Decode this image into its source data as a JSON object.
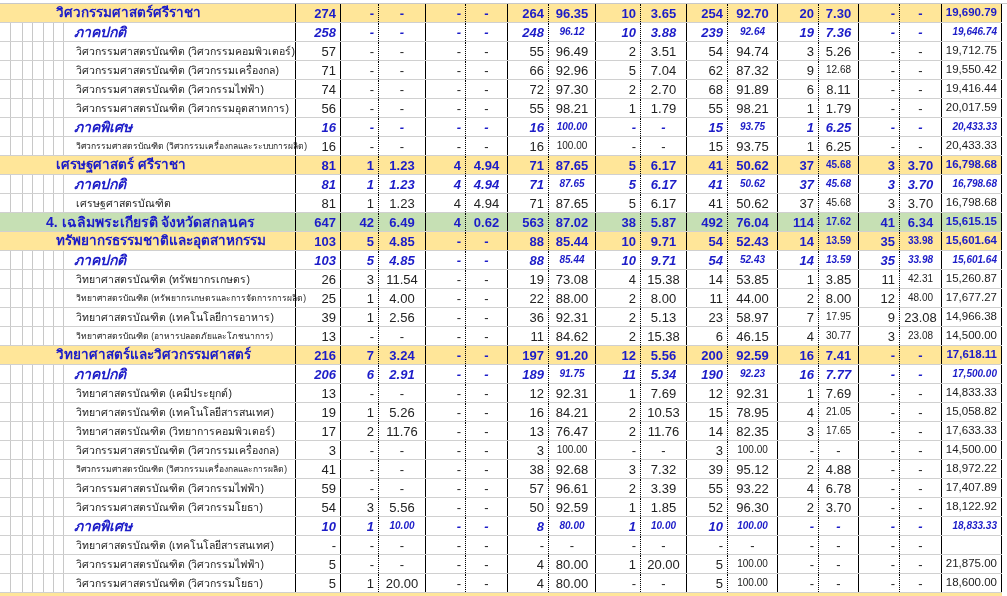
{
  "rows": [
    {
      "kind": "faculty",
      "label": "วิศวกรรมศาสตร์ศรีราชา",
      "cells": [
        "274",
        "-",
        "-",
        "-",
        "-",
        "264",
        "96.35",
        "10",
        "3.65",
        "254",
        "92.70",
        "20",
        "7.30",
        "-",
        "-",
        "19,690.79"
      ]
    },
    {
      "kind": "section",
      "label": "ภาคปกติ",
      "cells": [
        "258",
        "-",
        "-",
        "-",
        "-",
        "248",
        {
          "text": "96.12",
          "shrunk": true
        },
        "10",
        "3.88",
        "239",
        {
          "text": "92.64",
          "shrunk": true
        },
        "19",
        "7.36",
        "-",
        "-",
        {
          "text": "19,646.74",
          "shrunk": true
        }
      ]
    },
    {
      "kind": "program",
      "compact": false,
      "label": "วิศวกรรมศาสตรบัณฑิต (วิศวกรรมคอมพิวเตอร์)",
      "cells": [
        "57",
        "-",
        "-",
        "-",
        "-",
        "55",
        "96.49",
        "2",
        "3.51",
        "54",
        "94.74",
        "3",
        "5.26",
        "-",
        "-",
        "19,712.75"
      ]
    },
    {
      "kind": "program",
      "compact": false,
      "label": "วิศวกรรมศาสตรบัณฑิต (วิศวกรรมเครื่องกล)",
      "cells": [
        "71",
        "-",
        "-",
        "-",
        "-",
        "66",
        "92.96",
        "5",
        "7.04",
        "62",
        "87.32",
        "9",
        {
          "text": "12.68",
          "shrunk": true
        },
        "-",
        "-",
        "19,550.42"
      ]
    },
    {
      "kind": "program",
      "compact": false,
      "label": "วิศวกรรมศาสตรบัณฑิต (วิศวกรรมไฟฟ้า)",
      "cells": [
        "74",
        "-",
        "-",
        "-",
        "-",
        "72",
        "97.30",
        "2",
        "2.70",
        "68",
        "91.89",
        "6",
        "8.11",
        "-",
        "-",
        "19,416.44"
      ]
    },
    {
      "kind": "program",
      "compact": false,
      "label": "วิศวกรรมศาสตรบัณฑิต (วิศวกรรมอุตสาหการ)",
      "cells": [
        "56",
        "-",
        "-",
        "-",
        "-",
        "55",
        "98.21",
        "1",
        "1.79",
        "55",
        "98.21",
        "1",
        "1.79",
        "-",
        "-",
        "20,017.59"
      ]
    },
    {
      "kind": "section",
      "label": "ภาคพิเศษ",
      "cells": [
        "16",
        "-",
        "-",
        "-",
        "-",
        "16",
        {
          "text": "100.00",
          "shrunk": true
        },
        "-",
        "-",
        "15",
        {
          "text": "93.75",
          "shrunk": true
        },
        "1",
        "6.25",
        "-",
        "-",
        {
          "text": "20,433.33",
          "shrunk": true
        }
      ]
    },
    {
      "kind": "program",
      "compact": true,
      "label": "วิศวกรรมศาสตรบัณฑิต (วิศวกรรมเครื่องกลและระบบการผลิต)",
      "cells": [
        "16",
        "-",
        "-",
        "-",
        "-",
        "16",
        {
          "text": "100.00",
          "shrunk": true
        },
        "-",
        "-",
        "15",
        "93.75",
        "1",
        "6.25",
        "-",
        "-",
        "20,433.33"
      ]
    },
    {
      "kind": "faculty",
      "label": "เศรษฐศาสตร์ ศรีราชา",
      "cells": [
        "81",
        "1",
        "1.23",
        "4",
        "4.94",
        "71",
        "87.65",
        "5",
        "6.17",
        "41",
        "50.62",
        "37",
        {
          "text": "45.68",
          "shrunk": true
        },
        "3",
        "3.70",
        "16,798.68"
      ]
    },
    {
      "kind": "section",
      "label": "ภาคปกติ",
      "cells": [
        "81",
        "1",
        "1.23",
        "4",
        "4.94",
        "71",
        {
          "text": "87.65",
          "shrunk": true
        },
        "5",
        "6.17",
        "41",
        {
          "text": "50.62",
          "shrunk": true
        },
        "37",
        {
          "text": "45.68",
          "shrunk": true
        },
        "3",
        "3.70",
        {
          "text": "16,798.68",
          "shrunk": true
        }
      ]
    },
    {
      "kind": "program",
      "compact": false,
      "label": "เศรษฐศาสตรบัณฑิต",
      "cells": [
        "81",
        "1",
        "1.23",
        "4",
        "4.94",
        "71",
        "87.65",
        "5",
        "6.17",
        "41",
        "50.62",
        "37",
        {
          "text": "45.68",
          "shrunk": true
        },
        "3",
        "3.70",
        "16,798.68"
      ]
    },
    {
      "kind": "campus",
      "label": "4. เฉลิมพระเกียรติ จังหวัดสกลนคร",
      "cells": [
        "647",
        "42",
        "6.49",
        "4",
        "0.62",
        "563",
        "87.02",
        "38",
        "5.87",
        "492",
        "76.04",
        "114",
        {
          "text": "17.62",
          "shrunk": true
        },
        "41",
        "6.34",
        "15,615.15"
      ]
    },
    {
      "kind": "faculty",
      "label": "ทรัพยากรธรรมชาติและอุตสาหกรรม",
      "cells": [
        "103",
        "5",
        "4.85",
        "-",
        "-",
        "88",
        "85.44",
        "10",
        "9.71",
        "54",
        "52.43",
        "14",
        {
          "text": "13.59",
          "shrunk": true
        },
        "35",
        {
          "text": "33.98",
          "shrunk": true
        },
        "15,601.64"
      ]
    },
    {
      "kind": "section",
      "label": "ภาคปกติ",
      "cells": [
        "103",
        "5",
        "4.85",
        "-",
        "-",
        "88",
        {
          "text": "85.44",
          "shrunk": true
        },
        "10",
        "9.71",
        "54",
        {
          "text": "52.43",
          "shrunk": true
        },
        "14",
        {
          "text": "13.59",
          "shrunk": true
        },
        "35",
        {
          "text": "33.98",
          "shrunk": true
        },
        {
          "text": "15,601.64",
          "shrunk": true
        }
      ]
    },
    {
      "kind": "program",
      "compact": false,
      "label": "วิทยาศาสตรบัณฑิต (ทรัพยากรเกษตร)",
      "cells": [
        "26",
        "3",
        "11.54",
        "-",
        "-",
        "19",
        "73.08",
        "4",
        "15.38",
        "14",
        "53.85",
        "1",
        "3.85",
        "11",
        {
          "text": "42.31",
          "shrunk": true
        },
        "15,260.87"
      ]
    },
    {
      "kind": "program",
      "compact": true,
      "label": "วิทยาศาสตรบัณฑิต (ทรัพยากรเกษตรและการจัดการการผลิต)",
      "cells": [
        "25",
        "1",
        "4.00",
        "-",
        "-",
        "22",
        "88.00",
        "2",
        "8.00",
        "11",
        "44.00",
        "2",
        "8.00",
        "12",
        {
          "text": "48.00",
          "shrunk": true
        },
        "17,677.27"
      ]
    },
    {
      "kind": "program",
      "compact": false,
      "label": "วิทยาศาสตรบัณฑิต (เทคโนโลยีการอาหาร)",
      "cells": [
        "39",
        "1",
        "2.56",
        "-",
        "-",
        "36",
        "92.31",
        "2",
        "5.13",
        "23",
        "58.97",
        "7",
        {
          "text": "17.95",
          "shrunk": true
        },
        "9",
        "23.08",
        "14,966.38"
      ]
    },
    {
      "kind": "program",
      "compact": true,
      "label": "วิทยาศาสตรบัณฑิต (อาหารปลอดภัยและโภชนาการ)",
      "cells": [
        "13",
        "-",
        "-",
        "-",
        "-",
        "11",
        "84.62",
        "2",
        "15.38",
        "6",
        "46.15",
        "4",
        {
          "text": "30.77",
          "shrunk": true
        },
        "3",
        {
          "text": "23.08",
          "shrunk": true
        },
        "14,500.00"
      ]
    },
    {
      "kind": "faculty",
      "label": "วิทยาศาสตร์และวิศวกรรมศาสตร์",
      "cells": [
        "216",
        "7",
        "3.24",
        "-",
        "-",
        "197",
        "91.20",
        "12",
        "5.56",
        "200",
        "92.59",
        "16",
        "7.41",
        "-",
        "-",
        "17,618.11"
      ]
    },
    {
      "kind": "section",
      "label": "ภาคปกติ",
      "cells": [
        "206",
        "6",
        "2.91",
        "-",
        "-",
        "189",
        {
          "text": "91.75",
          "shrunk": true
        },
        "11",
        "5.34",
        "190",
        {
          "text": "92.23",
          "shrunk": true
        },
        "16",
        "7.77",
        "-",
        "-",
        {
          "text": "17,500.00",
          "shrunk": true
        }
      ]
    },
    {
      "kind": "program",
      "compact": false,
      "label": "วิทยาศาสตรบัณฑิต (เคมีประยุกต์)",
      "cells": [
        "13",
        "-",
        "-",
        "-",
        "-",
        "12",
        "92.31",
        "1",
        "7.69",
        "12",
        "92.31",
        "1",
        "7.69",
        "-",
        "-",
        "14,833.33"
      ]
    },
    {
      "kind": "program",
      "compact": false,
      "label": "วิทยาศาสตรบัณฑิต (เทคโนโลยีสารสนเทศ)",
      "cells": [
        "19",
        "1",
        "5.26",
        "-",
        "-",
        "16",
        "84.21",
        "2",
        "10.53",
        "15",
        "78.95",
        "4",
        {
          "text": "21.05",
          "shrunk": true
        },
        "-",
        "-",
        "15,058.82"
      ]
    },
    {
      "kind": "program",
      "compact": false,
      "label": "วิทยาศาสตรบัณฑิต (วิทยาการคอมพิวเตอร์)",
      "cells": [
        "17",
        "2",
        "11.76",
        "-",
        "-",
        "13",
        "76.47",
        "2",
        "11.76",
        "14",
        "82.35",
        "3",
        {
          "text": "17.65",
          "shrunk": true
        },
        "-",
        "-",
        "17,633.33"
      ]
    },
    {
      "kind": "program",
      "compact": false,
      "label": "วิศวกรรมศาสตรบัณฑิต (วิศวกรรมเครื่องกล)",
      "cells": [
        "3",
        "-",
        "-",
        "-",
        "-",
        "3",
        {
          "text": "100.00",
          "shrunk": true
        },
        "-",
        "-",
        "3",
        {
          "text": "100.00",
          "shrunk": true
        },
        "-",
        "-",
        "-",
        "-",
        "14,500.00"
      ]
    },
    {
      "kind": "program",
      "compact": true,
      "label": "วิศวกรรมศาสตรบัณฑิต (วิศวกรรมเครื่องกลและการผลิต)",
      "cells": [
        "41",
        "-",
        "-",
        "-",
        "-",
        "38",
        "92.68",
        "3",
        "7.32",
        "39",
        "95.12",
        "2",
        "4.88",
        "-",
        "-",
        "18,972.22"
      ]
    },
    {
      "kind": "program",
      "compact": false,
      "label": "วิศวกรรมศาสตรบัณฑิต (วิศวกรรมไฟฟ้า)",
      "cells": [
        "59",
        "-",
        "-",
        "-",
        "-",
        "57",
        "96.61",
        "2",
        "3.39",
        "55",
        "93.22",
        "4",
        "6.78",
        "-",
        "-",
        "17,407.89"
      ]
    },
    {
      "kind": "program",
      "compact": false,
      "label": "วิศวกรรมศาสตรบัณฑิต (วิศวกรรมโยธา)",
      "cells": [
        "54",
        "3",
        "5.56",
        "-",
        "-",
        "50",
        "92.59",
        "1",
        "1.85",
        "52",
        "96.30",
        "2",
        "3.70",
        "-",
        "-",
        "18,122.92"
      ]
    },
    {
      "kind": "section",
      "label": "ภาคพิเศษ",
      "cells": [
        "10",
        "1",
        {
          "text": "10.00",
          "shrunk": true
        },
        "-",
        "-",
        "8",
        {
          "text": "80.00",
          "shrunk": true
        },
        "1",
        {
          "text": "10.00",
          "shrunk": true
        },
        "10",
        {
          "text": "100.00",
          "shrunk": true
        },
        "-",
        "-",
        "-",
        "-",
        {
          "text": "18,833.33",
          "shrunk": true
        }
      ]
    },
    {
      "kind": "program",
      "compact": false,
      "label": "วิทยาศาสตรบัณฑิต (เทคโนโลยีสารสนเทศ)",
      "cells": [
        "-",
        "-",
        "-",
        "-",
        "-",
        "-",
        "-",
        "-",
        "-",
        "-",
        "-",
        "-",
        "-",
        "-",
        "-",
        null
      ]
    },
    {
      "kind": "program",
      "compact": false,
      "label": "วิศวกรรมศาสตรบัณฑิต (วิศวกรรมไฟฟ้า)",
      "cells": [
        "5",
        "-",
        "-",
        "-",
        "-",
        "4",
        "80.00",
        "1",
        "20.00",
        "5",
        {
          "text": "100.00",
          "shrunk": true
        },
        "-",
        "-",
        "-",
        "-",
        "21,875.00"
      ]
    },
    {
      "kind": "program",
      "compact": false,
      "label": "วิศวกรรมศาสตรบัณฑิต (วิศวกรรมโยธา)",
      "cells": [
        "5",
        "1",
        "20.00",
        "-",
        "-",
        "4",
        "80.00",
        "-",
        "-",
        "5",
        {
          "text": "100.00",
          "shrunk": true
        },
        "-",
        "-",
        "-",
        "-",
        "18,600.00"
      ]
    }
  ]
}
